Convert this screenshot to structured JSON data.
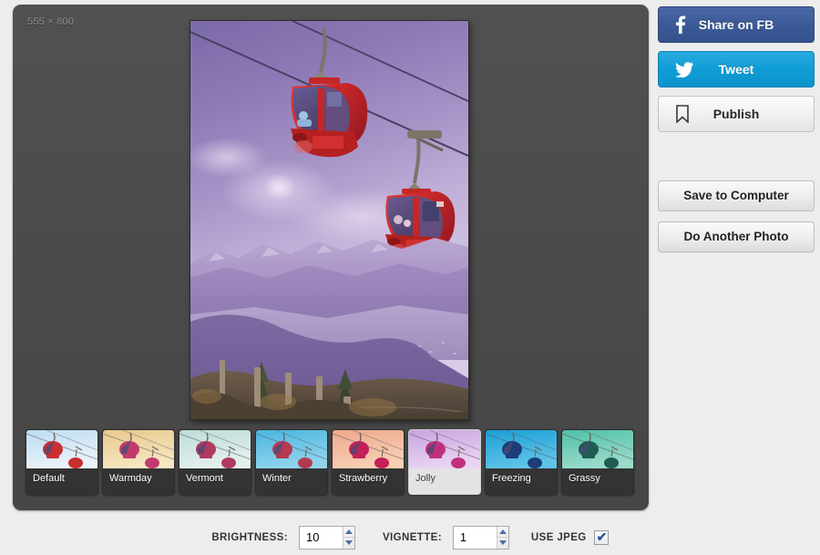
{
  "editor": {
    "dimensions_label": "555 × 800",
    "photo_alt": "two red mountain gondola cable cars over purple mountains"
  },
  "filters": [
    {
      "name": "Default",
      "selected": false,
      "sky_top": "#bcdcf2",
      "sky_bottom": "#eaf3fa",
      "cabin": "#c92f2f",
      "hue": 0
    },
    {
      "name": "Warmday",
      "selected": false,
      "sky_top": "#e8c98c",
      "sky_bottom": "#f6e6c0",
      "cabin": "#c23a6d",
      "hue": 25
    },
    {
      "name": "Vermont",
      "selected": false,
      "sky_top": "#bcdcd8",
      "sky_bottom": "#e3f0ee",
      "cabin": "#b03a5e",
      "hue": 140
    },
    {
      "name": "Winter",
      "selected": false,
      "sky_top": "#49b6e0",
      "sky_bottom": "#8fd4ec",
      "cabin": "#b53a50",
      "hue": 195
    },
    {
      "name": "Strawberry",
      "selected": false,
      "sky_top": "#efa88c",
      "sky_bottom": "#f7cfb4",
      "cabin": "#c41f56",
      "hue": 10
    },
    {
      "name": "Jolly",
      "selected": true,
      "sky_top": "#c9a3e0",
      "sky_bottom": "#e8d4f2",
      "cabin": "#c0307a",
      "hue": 285
    },
    {
      "name": "Freezing",
      "selected": false,
      "sky_top": "#1a9fd6",
      "sky_bottom": "#5fc3e8",
      "cabin": "#1d3d7a",
      "hue": 210
    },
    {
      "name": "Grassy",
      "selected": false,
      "sky_top": "#4fc0a8",
      "sky_bottom": "#9adbca",
      "cabin": "#1f5c52",
      "hue": 160
    }
  ],
  "actions": {
    "share_fb_label": "Share on FB",
    "share_fb_icon": "facebook-f-icon",
    "share_fb_color": "#3b5a97",
    "tweet_label": "Tweet",
    "tweet_icon": "twitter-bird-icon",
    "tweet_color": "#0f9dd6",
    "publish_label": "Publish",
    "publish_icon": "bookmark-icon",
    "save_label": "Save to Computer",
    "another_photo_label": "Do Another Photo"
  },
  "controls": {
    "brightness_label": "BRIGHTNESS:",
    "brightness_value": "10",
    "vignette_label": "VIGNETTE:",
    "vignette_value": "1",
    "use_jpeg_label": "USE JPEG",
    "use_jpeg_checked": true,
    "check_glyph": "✔"
  }
}
